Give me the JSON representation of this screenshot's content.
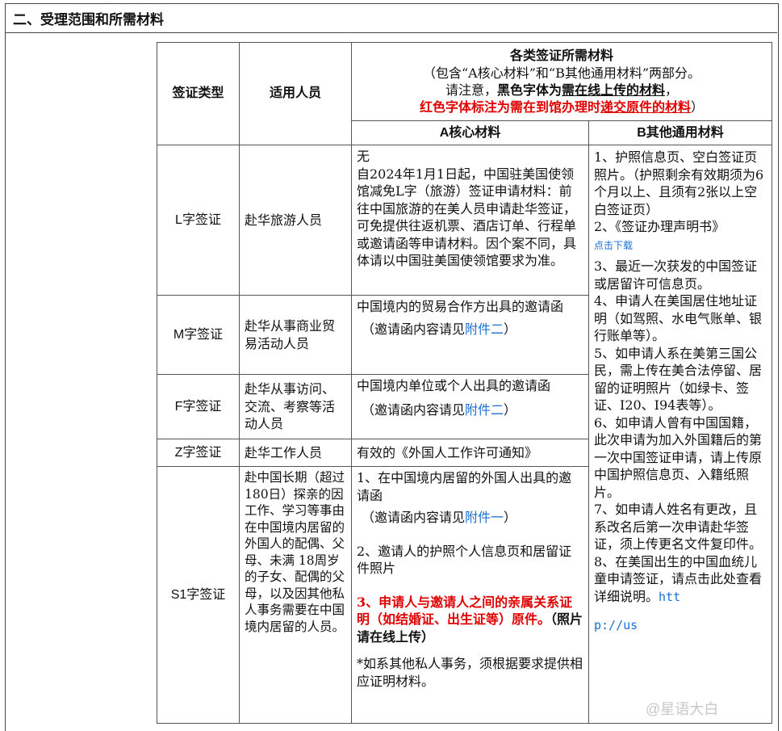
{
  "section": {
    "title": "二、受理范围和所需材料"
  },
  "header": {
    "visa_type": "签证类型",
    "applicants": "适用人员",
    "materials_title": "各类签证所需材料",
    "line1": "（包含“A核心材料”和“B其他通用材料”两部分。",
    "line2a": "请注意，",
    "line2b": "黑色字体为",
    "line2c": "需在线上传的材料",
    "line2d": "，",
    "line3a": "红色字体标注为需在到馆办理时",
    "line3b": "递交原件的材料",
    "line3c": "）",
    "col_a": "A核心材料",
    "col_b": "B其他通用材料"
  },
  "rows": {
    "l": {
      "type": "L字签证",
      "applicant": "赴华旅游人员",
      "core1": "无",
      "core2": "自2024年1月1日起，中国驻美国使领馆减免L字（旅游）签证申请材料：前往中国旅游的在美人员申请赴华签证，可免提供往返机票、酒店订单、行程单或邀请函等申请材料。因个案不同，具体请以中国驻美国使领馆要求为准。"
    },
    "m": {
      "type": "M字签证",
      "applicant": "赴华从事商业贸易活动人员",
      "core1": "中国境内的贸易合作方出具的邀请函",
      "note_pre": "（邀请函内容请见",
      "note_link": "附件二",
      "note_post": "）"
    },
    "f": {
      "type": "F字签证",
      "applicant": "赴华从事访问、交流、考察等活动人员",
      "core1": "中国境内单位或个人出具的邀请函",
      "note_pre": "（邀请函内容请见",
      "note_link": "附件二",
      "note_post": "）"
    },
    "z": {
      "type": "Z字签证",
      "applicant": "赴华工作人员",
      "core1": "有效的《外国人工作许可通知》"
    },
    "s1": {
      "type": "S1字签证",
      "applicant": "赴中国长期（超过180日）探亲的因工作、学习等事由在中国境内居留的外国人的配偶、父母、未满 18周岁的子女、配偶的父母，以及因其他私人事务需要在中国境内居留的人员。",
      "core1": "1、在中国境内居留的外国人出具的邀请函",
      "note_pre": "（邀请函内容请见",
      "note_link": "附件一",
      "note_post": "）",
      "core2": "2、邀请人的护照个人信息页和居留证件照片",
      "core3_red": "3、申请人与邀请人之间的亲属关系证明（如结婚证、出生证等）原件。",
      "core3_black": "（照片请在线上传）",
      "core4": "*如系其他私人事务，须根据要求提供相应证明材料。"
    }
  },
  "common": {
    "b1": "1、护照信息页、空白签证页照片。（护照剩余有效期须为6个月以上、且须有2张以上空白签证页）",
    "b2": "2、《签证办理声明书》",
    "b2_link": "点击下载",
    "b3": "3、最近一次获发的中国签证或居留许可信息页。",
    "b4": "4、申请人在美国居住地址证明（如驾照、水电气账单、银行账单等）。",
    "b5": "5、如申请人系在美第三国公民，需上传在美合法停留、居留的证明照片（如绿卡、签证、I20、I94表等）。",
    "b6": "6、如申请人曾有中国国籍，此次申请为加入外国籍后的第一次中国签证申请，请上传原中国护照信息页、入籍纸照片。",
    "b7": "7、如申请人姓名有更改，且系改名后第一次申请赴华签证，须上传更名文件复印件。",
    "b8": "8、在美国出生的中国血统儿童申请签证，请点击此处查看详细说明。",
    "link1": "htt",
    "link2": "p://us"
  },
  "watermark": "@星语大白"
}
